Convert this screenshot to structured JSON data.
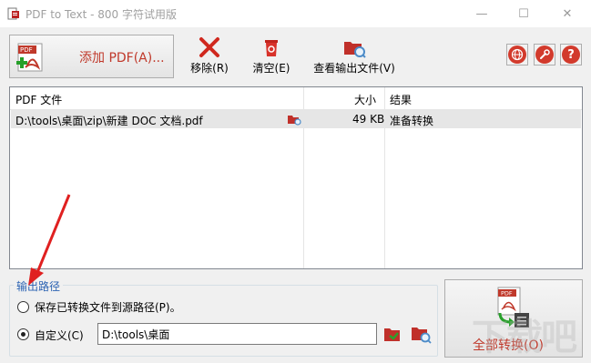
{
  "window": {
    "title": "PDF to Text - 800 字符试用版",
    "minimize": "—",
    "maximize": "☐",
    "close": "✕"
  },
  "toolbar": {
    "add_pdf": "添加 PDF(A)...",
    "remove": "移除(R)",
    "clear": "清空(E)",
    "view_output": "查看输出文件(V)",
    "web_icon": "globe-icon",
    "settings_icon": "wrench-icon",
    "help_icon": "help-icon",
    "help_glyph": "?"
  },
  "file_list": {
    "columns": [
      "PDF 文件",
      "大小",
      "结果"
    ],
    "rows": [
      {
        "file": "D:\\tools\\桌面\\zip\\新建 DOC 文档.pdf",
        "size": "49 KB",
        "result": "准备转换"
      }
    ]
  },
  "output": {
    "group_title": "输出路径",
    "option_source": "保存已转换文件到源路径(P)。",
    "option_custom": "自定义(C)",
    "custom_path": "D:\\tools\\桌面",
    "selected": "custom"
  },
  "convert": {
    "label": "全部转换(O)"
  },
  "watermark": "下载吧",
  "colors": {
    "accent_red": "#c0392b",
    "group_title": "#2d64b3",
    "row_highlight": "#e6e6e6",
    "arrow_red": "#e02020"
  }
}
